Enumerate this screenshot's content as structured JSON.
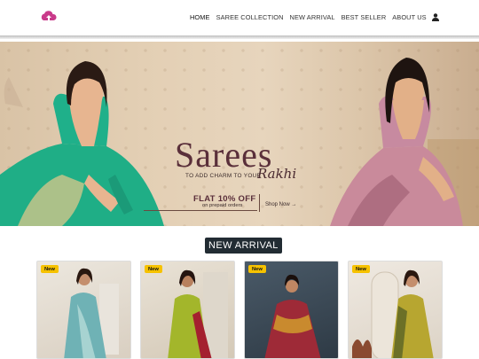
{
  "header": {
    "logo_icon": "cloud-logo-icon",
    "logo_color": "#d43e8e",
    "nav": [
      "HOME",
      "SAREE COLLECTION",
      "NEW ARRIVAL",
      "BEST SELLER",
      "ABOUT US"
    ],
    "user_icon": "user-icon"
  },
  "banner": {
    "headline": "Sarees",
    "tagline": "TO ADD CHARM TO YOUR",
    "script": "Rakhi",
    "offer": "FLAT 10% OFF",
    "offer_sub": "on prepaid orders",
    "cta": "Shop Now →"
  },
  "section": {
    "title": "NEW ARRIVAL"
  },
  "products": [
    {
      "badge": "New",
      "saree_color": "#6fb2b5"
    },
    {
      "badge": "New",
      "saree_color": "#a3b62b"
    },
    {
      "badge": "New",
      "saree_color": "#9e2a37"
    },
    {
      "badge": "New",
      "saree_color": "#b7a630"
    }
  ],
  "colors": {
    "badge": "#f6c200",
    "section_title_bg": "#222c33"
  }
}
